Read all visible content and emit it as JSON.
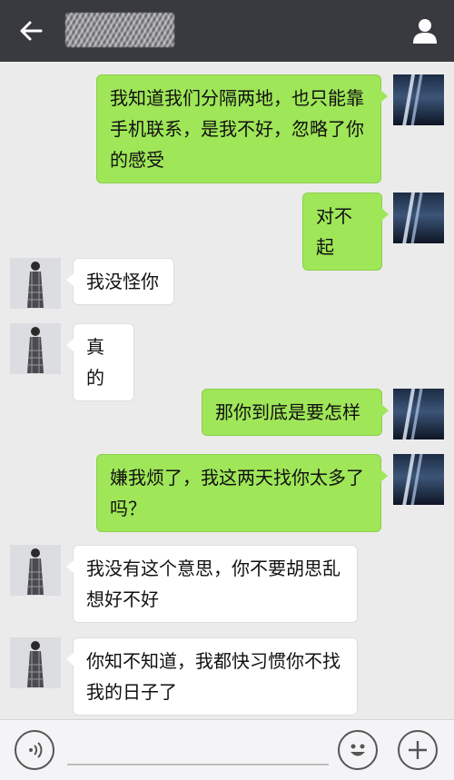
{
  "header": {
    "contact_name": "████",
    "back_icon": "arrow-left-icon",
    "profile_icon": "person-icon"
  },
  "messages": [
    {
      "from": "me",
      "text": "我知道我们分隔两地，也只能靠手机联系，是我不好，忽略了你的感受"
    },
    {
      "from": "me",
      "text": "对不起"
    },
    {
      "from": "her",
      "text": "我没怪你"
    },
    {
      "from": "her",
      "text": "真的"
    },
    {
      "from": "me",
      "text": "那你到底是要怎样"
    },
    {
      "from": "me",
      "text": "嫌我烦了，我这两天找你太多了吗？"
    },
    {
      "from": "her",
      "text": "我没有这个意思，你不要胡思乱想好不好"
    },
    {
      "from": "her",
      "text": "你知不知道，我都快习惯你不找我的日子了"
    }
  ],
  "input": {
    "placeholder": "",
    "value": ""
  },
  "toolbar": {
    "voice_icon": "voice-icon",
    "emoji_icon": "emoji-icon",
    "plus_icon": "plus-icon"
  },
  "colors": {
    "topbar": "#393a3f",
    "bubble_me": "#9fe658",
    "bubble_her": "#ffffff",
    "background": "#ebebeb"
  }
}
